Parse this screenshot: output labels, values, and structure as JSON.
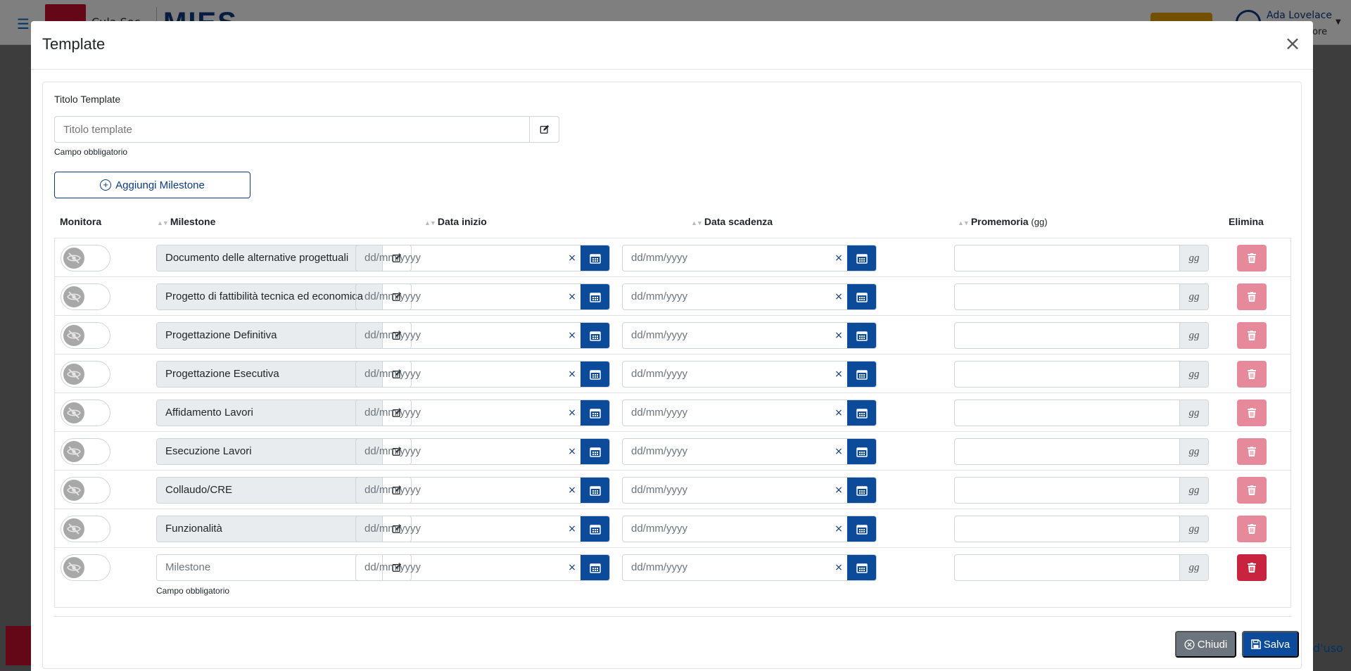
{
  "background": {
    "app_name": "MIES",
    "logo_text": "Cula Soc",
    "user_name": "Ada Lovelace",
    "user_role": "tore",
    "footer_text": "d'uso"
  },
  "modal": {
    "title": "Template",
    "close_symbol": "×"
  },
  "form": {
    "title_label": "Titolo Template",
    "title_placeholder": "Titolo template",
    "title_required": "Campo obbligatorio",
    "add_milestone_label": "Aggiungi Milestone"
  },
  "table": {
    "headers": {
      "monitor": "Monitora",
      "milestone": "Milestone",
      "start_date": "Data inizio",
      "due_date": "Data scadenza",
      "reminder": "Promemoria",
      "reminder_unit": "(gg)",
      "delete": "Elimina"
    },
    "date_placeholder": "dd/mm/yyyy",
    "clear_symbol": "×",
    "reminder_unit": "gg",
    "rows": [
      {
        "milestone": "Documento delle alternative progettuali"
      },
      {
        "milestone": "Progetto di fattibilità tecnica ed economica"
      },
      {
        "milestone": "Progettazione Definitiva"
      },
      {
        "milestone": "Progettazione Esecutiva"
      },
      {
        "milestone": "Affidamento Lavori"
      },
      {
        "milestone": "Esecuzione Lavori"
      },
      {
        "milestone": "Collaudo/CRE"
      },
      {
        "milestone": "Funzionalità"
      }
    ],
    "new_row": {
      "milestone_placeholder": "Milestone",
      "required": "Campo obbligatorio"
    }
  },
  "footer": {
    "close_label": "Chiudi",
    "save_label": "Salva"
  },
  "colors": {
    "primary": "#0c4a9a",
    "danger": "#c8233f",
    "danger_disabled": "#e6899a",
    "secondary": "#6c757d"
  }
}
